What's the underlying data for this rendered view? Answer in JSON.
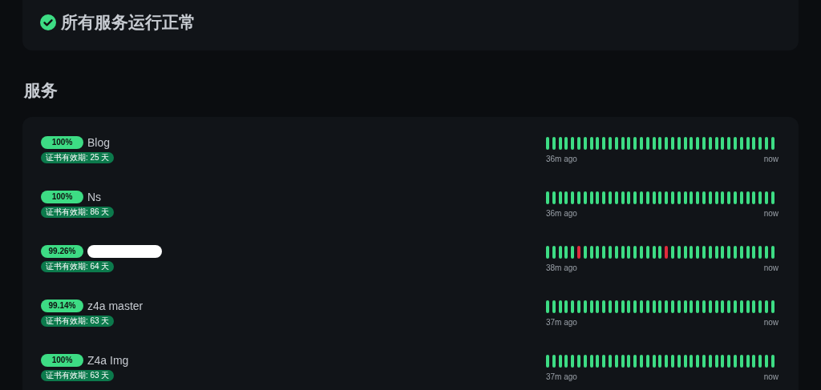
{
  "status": {
    "ok": true,
    "message": "所有服务运行正常"
  },
  "section_title": "服务",
  "services": [
    {
      "kind": "named",
      "uptime_label": "100%",
      "name": "Blog",
      "cert": "证书有效期: 25 天",
      "start": "36m ago",
      "end": "now",
      "beats": [
        {
          "up": true
        },
        {
          "up": true
        },
        {
          "up": true
        },
        {
          "up": true
        },
        {
          "up": true
        },
        {
          "up": true
        },
        {
          "up": true
        },
        {
          "up": true
        },
        {
          "up": true
        },
        {
          "up": true
        },
        {
          "up": true
        },
        {
          "up": true
        },
        {
          "up": true
        },
        {
          "up": true
        },
        {
          "up": true
        },
        {
          "up": true
        },
        {
          "up": true
        },
        {
          "up": true
        },
        {
          "up": true
        },
        {
          "up": true
        },
        {
          "up": true
        },
        {
          "up": true
        },
        {
          "up": true
        },
        {
          "up": true
        },
        {
          "up": true
        },
        {
          "up": true
        },
        {
          "up": true
        },
        {
          "up": true
        },
        {
          "up": true
        },
        {
          "up": true
        },
        {
          "up": true
        },
        {
          "up": true
        },
        {
          "up": true
        },
        {
          "up": true
        },
        {
          "up": true
        },
        {
          "up": true
        },
        {
          "up": true
        }
      ]
    },
    {
      "kind": "named",
      "uptime_label": "100%",
      "name": "Ns",
      "cert": "证书有效期: 86 天",
      "start": "36m ago",
      "end": "now",
      "beats": [
        {
          "up": true
        },
        {
          "up": true
        },
        {
          "up": true
        },
        {
          "up": true
        },
        {
          "up": true
        },
        {
          "up": true
        },
        {
          "up": true
        },
        {
          "up": true
        },
        {
          "up": true
        },
        {
          "up": true
        },
        {
          "up": true
        },
        {
          "up": true
        },
        {
          "up": true
        },
        {
          "up": true
        },
        {
          "up": true
        },
        {
          "up": true
        },
        {
          "up": true
        },
        {
          "up": true
        },
        {
          "up": true
        },
        {
          "up": true
        },
        {
          "up": true
        },
        {
          "up": true
        },
        {
          "up": true
        },
        {
          "up": true
        },
        {
          "up": true
        },
        {
          "up": true
        },
        {
          "up": true
        },
        {
          "up": true
        },
        {
          "up": true
        },
        {
          "up": true
        },
        {
          "up": true
        },
        {
          "up": true
        },
        {
          "up": true
        },
        {
          "up": true
        },
        {
          "up": true
        },
        {
          "up": true
        },
        {
          "up": true
        }
      ]
    },
    {
      "kind": "redacted",
      "uptime_label": "99.26%",
      "cert": "证书有效期: 64 天",
      "start": "38m ago",
      "end": "now",
      "beats": [
        {
          "up": true
        },
        {
          "up": true
        },
        {
          "up": true
        },
        {
          "up": true
        },
        {
          "up": true
        },
        {
          "up": false
        },
        {
          "up": true
        },
        {
          "up": true
        },
        {
          "up": true
        },
        {
          "up": true
        },
        {
          "up": true
        },
        {
          "up": true
        },
        {
          "up": true
        },
        {
          "up": true
        },
        {
          "up": true
        },
        {
          "up": true
        },
        {
          "up": true
        },
        {
          "up": true
        },
        {
          "up": true
        },
        {
          "up": false
        },
        {
          "up": true
        },
        {
          "up": true
        },
        {
          "up": true
        },
        {
          "up": true
        },
        {
          "up": true
        },
        {
          "up": true
        },
        {
          "up": true
        },
        {
          "up": true
        },
        {
          "up": true
        },
        {
          "up": true
        },
        {
          "up": true
        },
        {
          "up": true
        },
        {
          "up": true
        },
        {
          "up": true
        },
        {
          "up": true
        },
        {
          "up": true
        },
        {
          "up": true
        }
      ]
    },
    {
      "kind": "named",
      "uptime_label": "99.14%",
      "name": "z4a master",
      "cert": "证书有效期: 63 天",
      "start": "37m ago",
      "end": "now",
      "beats": [
        {
          "up": true
        },
        {
          "up": true
        },
        {
          "up": true
        },
        {
          "up": true
        },
        {
          "up": true
        },
        {
          "up": true
        },
        {
          "up": true
        },
        {
          "up": true
        },
        {
          "up": true
        },
        {
          "up": true
        },
        {
          "up": true
        },
        {
          "up": true
        },
        {
          "up": true
        },
        {
          "up": true
        },
        {
          "up": true
        },
        {
          "up": true
        },
        {
          "up": true
        },
        {
          "up": true
        },
        {
          "up": true
        },
        {
          "up": true
        },
        {
          "up": true
        },
        {
          "up": true
        },
        {
          "up": true
        },
        {
          "up": true
        },
        {
          "up": true
        },
        {
          "up": true
        },
        {
          "up": true
        },
        {
          "up": true
        },
        {
          "up": true
        },
        {
          "up": true
        },
        {
          "up": true
        },
        {
          "up": true
        },
        {
          "up": true
        },
        {
          "up": true
        },
        {
          "up": true
        },
        {
          "up": true
        },
        {
          "up": true
        }
      ]
    },
    {
      "kind": "named",
      "uptime_label": "100%",
      "name": "Z4a Img",
      "cert": "证书有效期: 63 天",
      "start": "37m ago",
      "end": "now",
      "beats": [
        {
          "up": true
        },
        {
          "up": true
        },
        {
          "up": true
        },
        {
          "up": true
        },
        {
          "up": true
        },
        {
          "up": true
        },
        {
          "up": true
        },
        {
          "up": true
        },
        {
          "up": true
        },
        {
          "up": true
        },
        {
          "up": true
        },
        {
          "up": true
        },
        {
          "up": true
        },
        {
          "up": true
        },
        {
          "up": true
        },
        {
          "up": true
        },
        {
          "up": true
        },
        {
          "up": true
        },
        {
          "up": true
        },
        {
          "up": true
        },
        {
          "up": true
        },
        {
          "up": true
        },
        {
          "up": true
        },
        {
          "up": true
        },
        {
          "up": true
        },
        {
          "up": true
        },
        {
          "up": true
        },
        {
          "up": true
        },
        {
          "up": true
        },
        {
          "up": true
        },
        {
          "up": true
        },
        {
          "up": true
        },
        {
          "up": true
        },
        {
          "up": true
        },
        {
          "up": true
        },
        {
          "up": true
        },
        {
          "up": true
        }
      ]
    }
  ]
}
